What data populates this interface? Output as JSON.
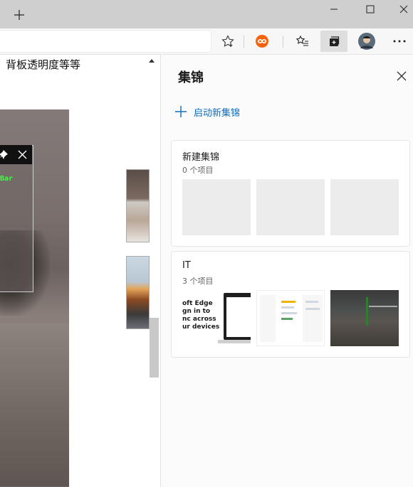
{
  "page": {
    "heading": "背板透明度等等",
    "screenshot_bar_label": "Bar"
  },
  "collections": {
    "pane_title": "集锦",
    "start_new_label": "启动新集锦",
    "items": [
      {
        "title": "新建集锦",
        "count": "0 个项目"
      },
      {
        "title": "IT",
        "count": "3 个项目"
      }
    ],
    "it_thumb_text": "oft Edge\ngn in to\nnc across\nur devices"
  },
  "colors": {
    "accent": "#0f6cbd",
    "titlebar": "#cfcfcf",
    "panel_bg": "#fbfbfb",
    "extension_badge": "#f7630c"
  },
  "icons": [
    "add-tab-icon",
    "minimize-icon",
    "maximize-icon",
    "close-icon",
    "favorite-star-icon",
    "extension-icon",
    "favorites-list-icon",
    "collections-icon",
    "profile-avatar-icon",
    "more-menu-icon",
    "pin-icon",
    "plus-icon"
  ]
}
